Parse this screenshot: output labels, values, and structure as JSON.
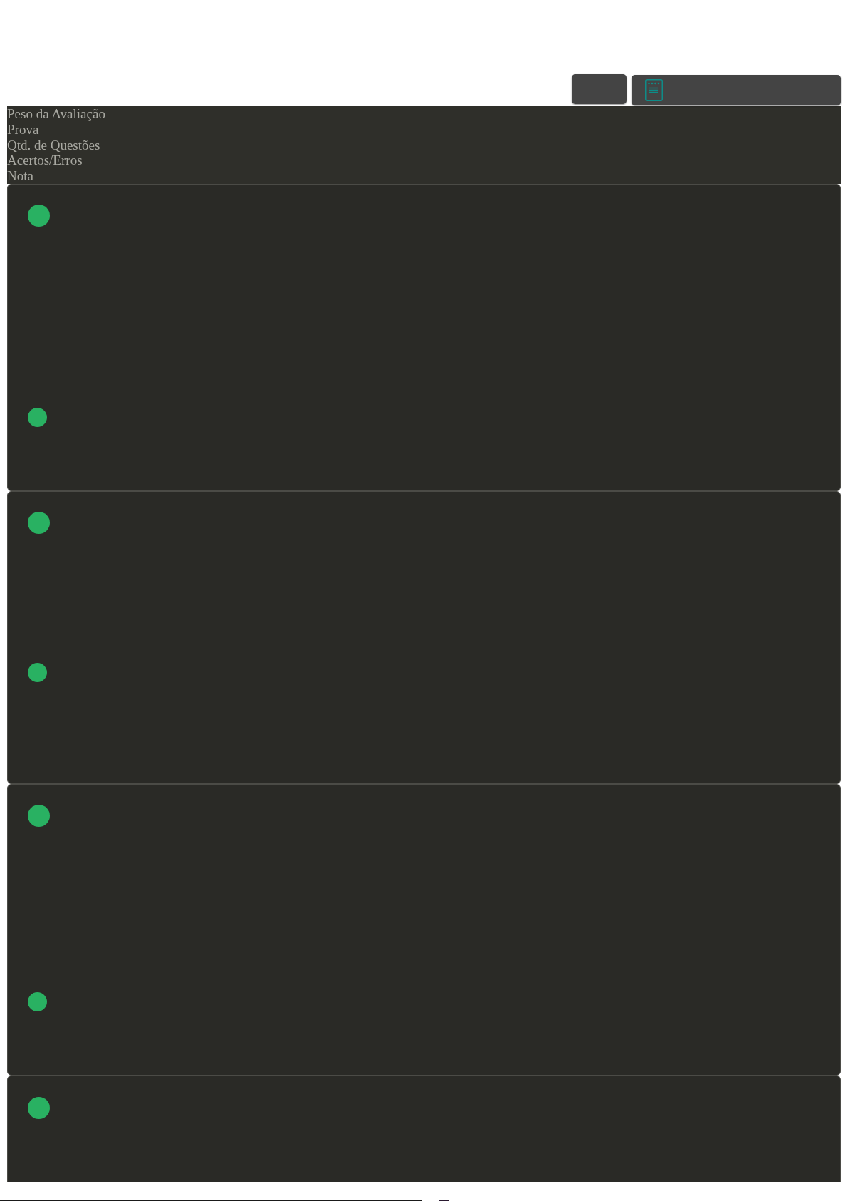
{
  "toolbar": {
    "buttons": [
      {
        "kind": "plain"
      },
      {
        "kind": "icon"
      }
    ]
  },
  "header": {
    "labels": [
      "Peso da Avaliação",
      "Prova",
      "Qtd. de Questões",
      "Acertos/Erros",
      "Nota"
    ]
  },
  "cards": [
    {
      "markers": [
        {
          "color": "#29b162"
        },
        {
          "color": "#29b162"
        }
      ]
    },
    {
      "markers": [
        {
          "color": "#29b162"
        },
        {
          "color": "#29b162"
        }
      ]
    },
    {
      "markers": [
        {
          "color": "#29b162"
        },
        {
          "color": "#29b162"
        }
      ]
    },
    {
      "markers": [
        {
          "color": "#29b162"
        }
      ]
    }
  ]
}
